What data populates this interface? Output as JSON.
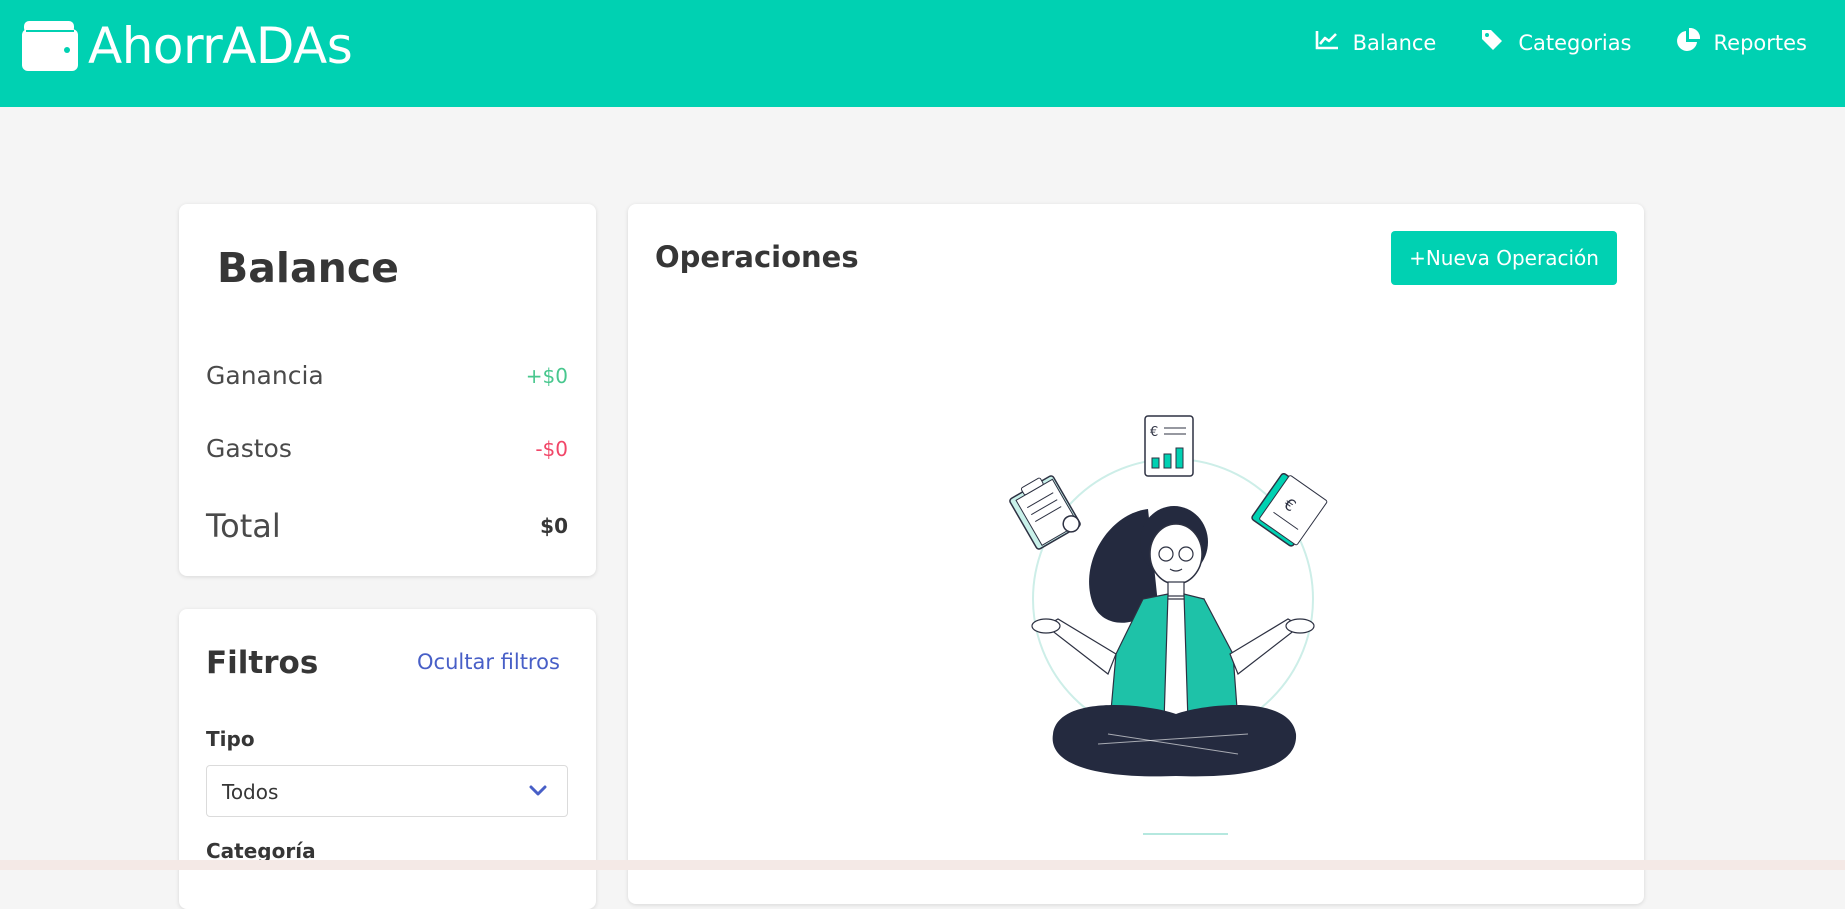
{
  "app": {
    "brand": "AhorrADAs",
    "icon": "wallet-icon",
    "accent_color": "#00d1b2"
  },
  "nav": {
    "items": [
      {
        "label": "Balance",
        "icon": "chart-line-icon"
      },
      {
        "label": "Categorias",
        "icon": "tag-icon"
      },
      {
        "label": "Reportes",
        "icon": "pie-chart-icon"
      }
    ]
  },
  "balance": {
    "title": "Balance",
    "rows": [
      {
        "label": "Ganancia",
        "value": "+$0",
        "color": "#48c78e"
      },
      {
        "label": "Gastos",
        "value": "-$0",
        "color": "#f14668"
      },
      {
        "label": "Total",
        "value": "$0",
        "color": "#363636"
      }
    ]
  },
  "filters": {
    "title": "Filtros",
    "toggle_label": "Ocultar filtros",
    "tipo_label": "Tipo",
    "tipo_value": "Todos",
    "categoria_label": "Categoría"
  },
  "operations": {
    "title": "Operaciones",
    "new_button": "+Nueva Operación",
    "illustration": "meditating-woman-finance-illustration"
  }
}
